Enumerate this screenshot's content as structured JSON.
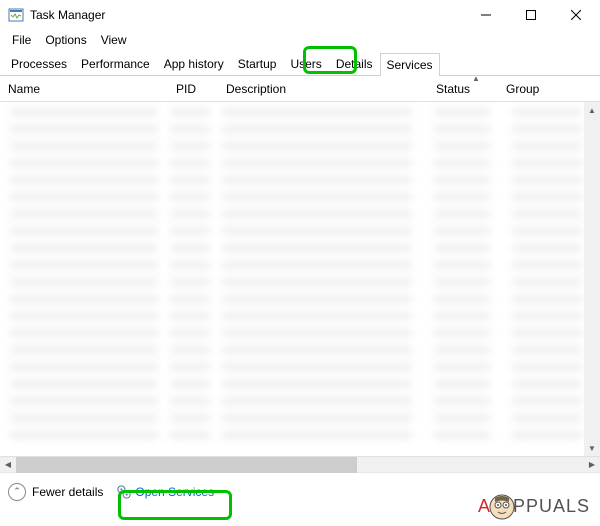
{
  "titlebar": {
    "title": "Task Manager"
  },
  "menubar": {
    "items": [
      "File",
      "Options",
      "View"
    ]
  },
  "tabs": {
    "items": [
      "Processes",
      "Performance",
      "App history",
      "Startup",
      "Users",
      "Details",
      "Services"
    ],
    "active": "Services"
  },
  "columns": {
    "name": "Name",
    "pid": "PID",
    "description": "Description",
    "status": "Status",
    "group": "Group"
  },
  "bottombar": {
    "fewer_details": "Fewer details",
    "open_services": "Open Services"
  },
  "watermark": {
    "brand_prefix": "A",
    "brand_rest": "PPUALS"
  }
}
